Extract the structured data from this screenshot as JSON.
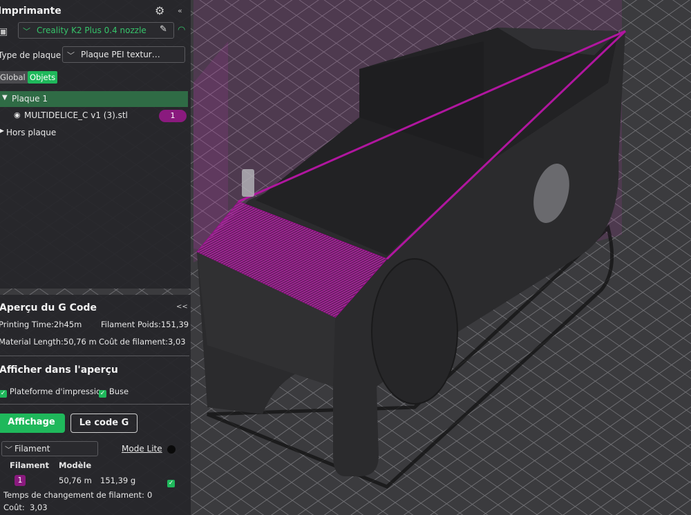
{
  "printer": {
    "title": "Imprimante",
    "printer_name": "Creality K2 Plus 0.4 nozzle",
    "plate_type_label": "Type de plaque",
    "plate_type_value": "Plaque PEI textur…"
  },
  "objects": {
    "tab_global": "Global",
    "tab_objects": "Objets",
    "plate_name": "Plaque 1",
    "object_name": "MULTIDELICE_C v1 (3).stl",
    "object_badge": "1",
    "outside_plate": "Hors plaque"
  },
  "gcode": {
    "title": "Aperçu du G Code",
    "collapse_label": "<<",
    "printing_time": "Printing Time:2h45m",
    "filament_weight": "Filament Poids:151,39",
    "material_length": "Material Length:50,76 m",
    "filament_cost": "Coût de filament:3,03",
    "preview_title": "Afficher dans l'aperçu",
    "check_platform": "Plateforme d'impressio",
    "check_nozzle": "Buse",
    "btn_display": "Affichage des",
    "btn_gcode": "Le code G",
    "view_select": "Filament",
    "mode_lite": "Mode Lite",
    "col_filament": "Filament",
    "col_model": "Modèle",
    "row_badge": "1",
    "row_length": "50,76 m",
    "row_weight": "151,39 g",
    "change_time": "Temps de changement de filament:",
    "change_time_value": "0",
    "cost_label": "Coût:",
    "cost_value": "3,03"
  },
  "colors": {
    "accent_green": "#36c46a",
    "filament_magenta": "#9b0f8e",
    "model_dark": "#2a2a2c"
  }
}
